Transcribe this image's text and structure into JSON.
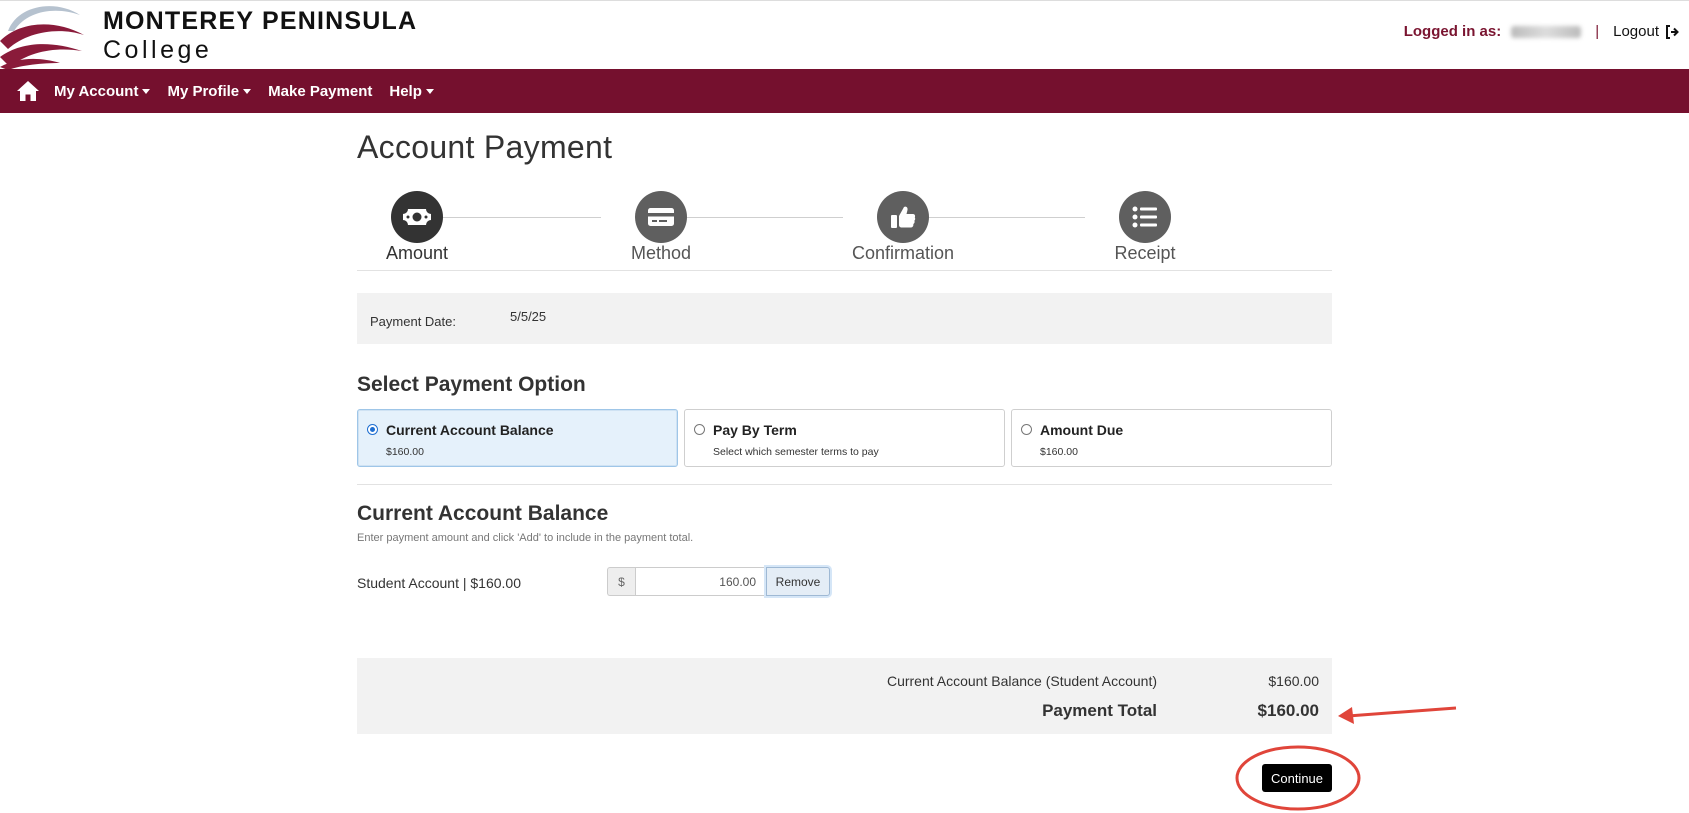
{
  "header": {
    "brand_line1": "MONTEREY PENINSULA",
    "brand_line2": "College",
    "logged_in_label": "Logged in as:",
    "separator": "|",
    "logout_label": "Logout",
    "logo_icon": "mpc-waves-logo",
    "logout_icon": "sign-out-icon"
  },
  "nav": {
    "home_icon": "home-icon",
    "items": [
      {
        "label": "My Account",
        "has_caret": true
      },
      {
        "label": "My Profile",
        "has_caret": true
      },
      {
        "label": "Make Payment",
        "has_caret": false
      },
      {
        "label": "Help",
        "has_caret": true
      }
    ],
    "bg_color": "#75102e"
  },
  "page": {
    "title": "Account Payment"
  },
  "steps": [
    {
      "label": "Amount",
      "icon": "money-bill-icon",
      "active": true
    },
    {
      "label": "Method",
      "icon": "credit-card-icon",
      "active": false
    },
    {
      "label": "Confirmation",
      "icon": "thumbs-up-icon",
      "active": false
    },
    {
      "label": "Receipt",
      "icon": "list-icon",
      "active": false
    }
  ],
  "payment_date": {
    "label": "Payment Date:",
    "value": "5/5/25"
  },
  "options_section": {
    "title": "Select Payment Option",
    "options": [
      {
        "name": "Current Account Balance",
        "sub": "$160.00",
        "selected": true
      },
      {
        "name": "Pay By Term",
        "sub": "Select which semester terms to pay",
        "selected": false
      },
      {
        "name": "Amount Due",
        "sub": "$160.00",
        "selected": false
      }
    ]
  },
  "balance_section": {
    "title": "Current Account Balance",
    "help": "Enter payment amount and click 'Add' to include in the payment total.",
    "account_label": "Student Account | $160.00",
    "currency_symbol": "$",
    "amount_value": "160.00",
    "remove_label": "Remove"
  },
  "summary": {
    "line_label": "Current Account Balance (Student Account)",
    "line_value": "$160.00",
    "total_label": "Payment Total",
    "total_value": "$160.00"
  },
  "continue_label": "Continue",
  "colors": {
    "brand": "#75102e",
    "annotation": "#e0453a"
  }
}
